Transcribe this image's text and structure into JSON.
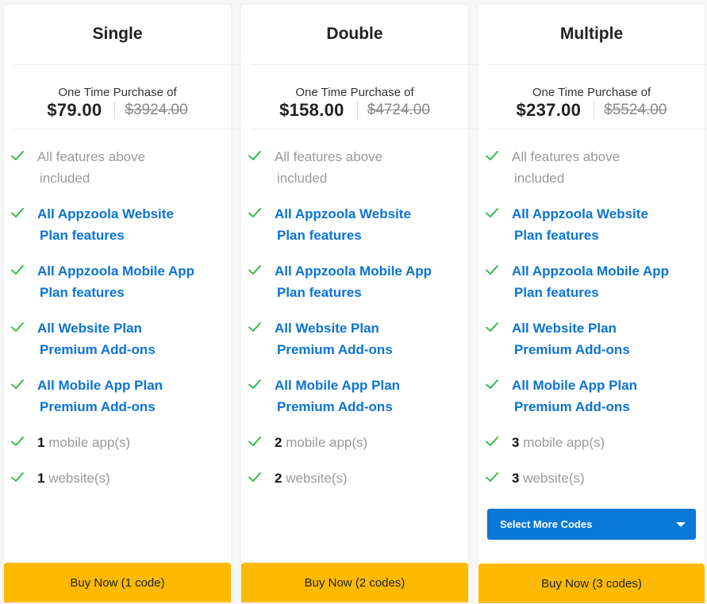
{
  "colors": {
    "check": "#28b446",
    "feature_link": "#0a73d6",
    "feature_muted": "#9a9a9a",
    "buy_button": "#fdba00",
    "select_button": "#0a78d7"
  },
  "plans": [
    {
      "title": "Single",
      "price_label": "One Time Purchase of",
      "price": "$79.00",
      "old_price": "$3924.00",
      "features": [
        {
          "line1": "All features above",
          "line2": "included",
          "style": "gray"
        },
        {
          "line1": "All Appzoola Website",
          "line2": "Plan features",
          "style": "blue"
        },
        {
          "line1": "All Appzoola Mobile App",
          "line2": "Plan features",
          "style": "blue"
        },
        {
          "line1": "All Website Plan",
          "line2": "Premium Add-ons",
          "style": "blue"
        },
        {
          "line1": "All Mobile App Plan",
          "line2": "Premium Add-ons",
          "style": "blue"
        }
      ],
      "apps": {
        "count": "1",
        "label": " mobile app(s)"
      },
      "websites": {
        "count": "1",
        "label": " website(s)"
      },
      "buy_label": "Buy Now (1 code)"
    },
    {
      "title": "Double",
      "price_label": "One Time Purchase of",
      "price": "$158.00",
      "old_price": "$4724.00",
      "features": [
        {
          "line1": "All features above",
          "line2": "included",
          "style": "gray"
        },
        {
          "line1": "All Appzoola Website",
          "line2": "Plan features",
          "style": "blue"
        },
        {
          "line1": "All Appzoola Mobile App",
          "line2": "Plan features",
          "style": "blue"
        },
        {
          "line1": "All Website Plan",
          "line2": "Premium Add-ons",
          "style": "blue"
        },
        {
          "line1": "All Mobile App Plan",
          "line2": "Premium Add-ons",
          "style": "blue"
        }
      ],
      "apps": {
        "count": "2",
        "label": " mobile app(s)"
      },
      "websites": {
        "count": "2",
        "label": " website(s)"
      },
      "buy_label": "Buy Now (2 codes)"
    },
    {
      "title": "Multiple",
      "price_label": "One Time Purchase of",
      "price": "$237.00",
      "old_price": "$5524.00",
      "features": [
        {
          "line1": "All features above",
          "line2": "included",
          "style": "gray"
        },
        {
          "line1": "All Appzoola Website",
          "line2": "Plan features",
          "style": "blue"
        },
        {
          "line1": "All Appzoola Mobile App",
          "line2": "Plan features",
          "style": "blue"
        },
        {
          "line1": "All Website Plan",
          "line2": "Premium Add-ons",
          "style": "blue"
        },
        {
          "line1": "All Mobile App Plan",
          "line2": "Premium Add-ons",
          "style": "blue"
        }
      ],
      "apps": {
        "count": "3",
        "label": " mobile app(s)"
      },
      "websites": {
        "count": "3",
        "label": " website(s)"
      },
      "select_label": "Select More Codes",
      "buy_label": "Buy Now (3 codes)"
    }
  ]
}
